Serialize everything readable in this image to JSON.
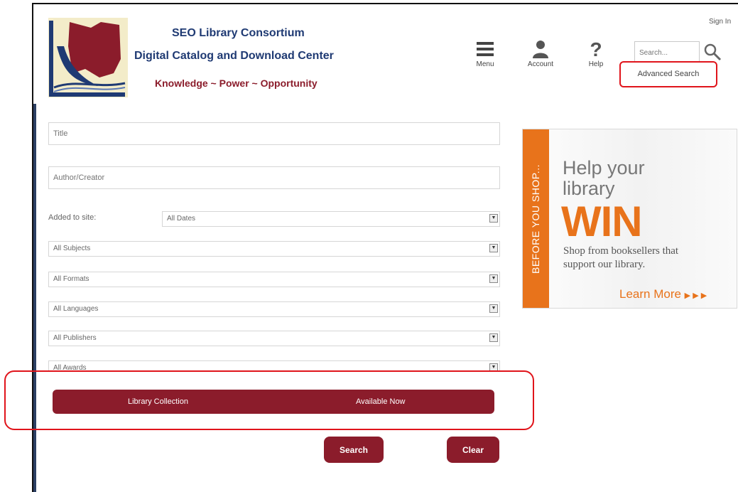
{
  "header": {
    "title": "SEO Library Consortium",
    "subtitle": "Digital Catalog and Download Center",
    "motto": "Knowledge ~ Power ~ Opportunity",
    "sign_in": "Sign In"
  },
  "nav": {
    "menu": {
      "label": "Menu",
      "icon": "hamburger-icon"
    },
    "account": {
      "label": "Account",
      "icon": "person-icon"
    },
    "help": {
      "label": "Help",
      "icon": "question-icon"
    },
    "search_placeholder": "Search...",
    "advanced_search": "Advanced Search"
  },
  "form": {
    "title_placeholder": "Title",
    "author_placeholder": "Author/Creator",
    "added_label": "Added to site:",
    "added_value": "All Dates",
    "subjects": "All Subjects",
    "formats": "All Formats",
    "languages": "All Languages",
    "publishers": "All Publishers",
    "awards": "All Awards",
    "collection_options": [
      "Library Collection",
      "Available Now"
    ],
    "search_button": "Search",
    "clear_button": "Clear"
  },
  "ad": {
    "side_text": "BEFORE YOU SHOP...",
    "headline": "Help your library",
    "big_word": "WIN",
    "body": "Shop from booksellers that support our library.",
    "cta": "Learn More",
    "accent_color": "#e8731b"
  },
  "colors": {
    "brand_blue": "#1f3a73",
    "brand_maroon": "#8b1c2b",
    "highlight_red": "#e0141b"
  }
}
